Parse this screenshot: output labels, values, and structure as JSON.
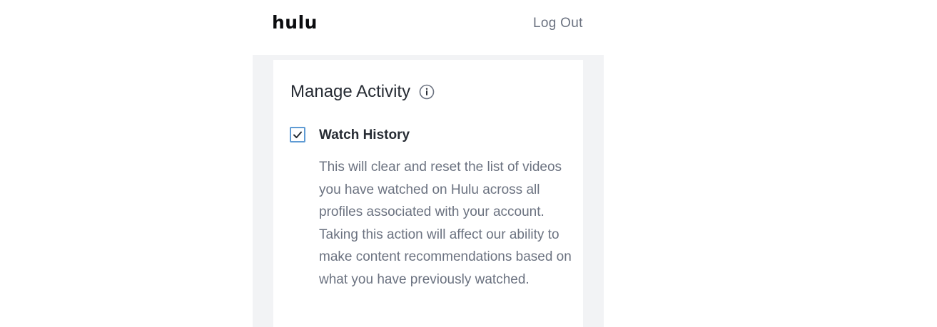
{
  "header": {
    "logo_text": "hulu",
    "logout_label": "Log Out"
  },
  "manage_activity": {
    "title": "Manage Activity",
    "info_icon": "info-icon",
    "watch_history": {
      "label": "Watch History",
      "checked": true,
      "description": "This will clear and reset the list of videos you have watched on Hulu across all profiles associated with your account. Taking this action will affect our ability to make content recommendations based on what you have previously watched."
    }
  },
  "colors": {
    "checkbox_border": "#5f9bd4",
    "panel_background": "#f2f3f5",
    "muted_text": "#6b7280",
    "primary_text": "#272c34"
  }
}
